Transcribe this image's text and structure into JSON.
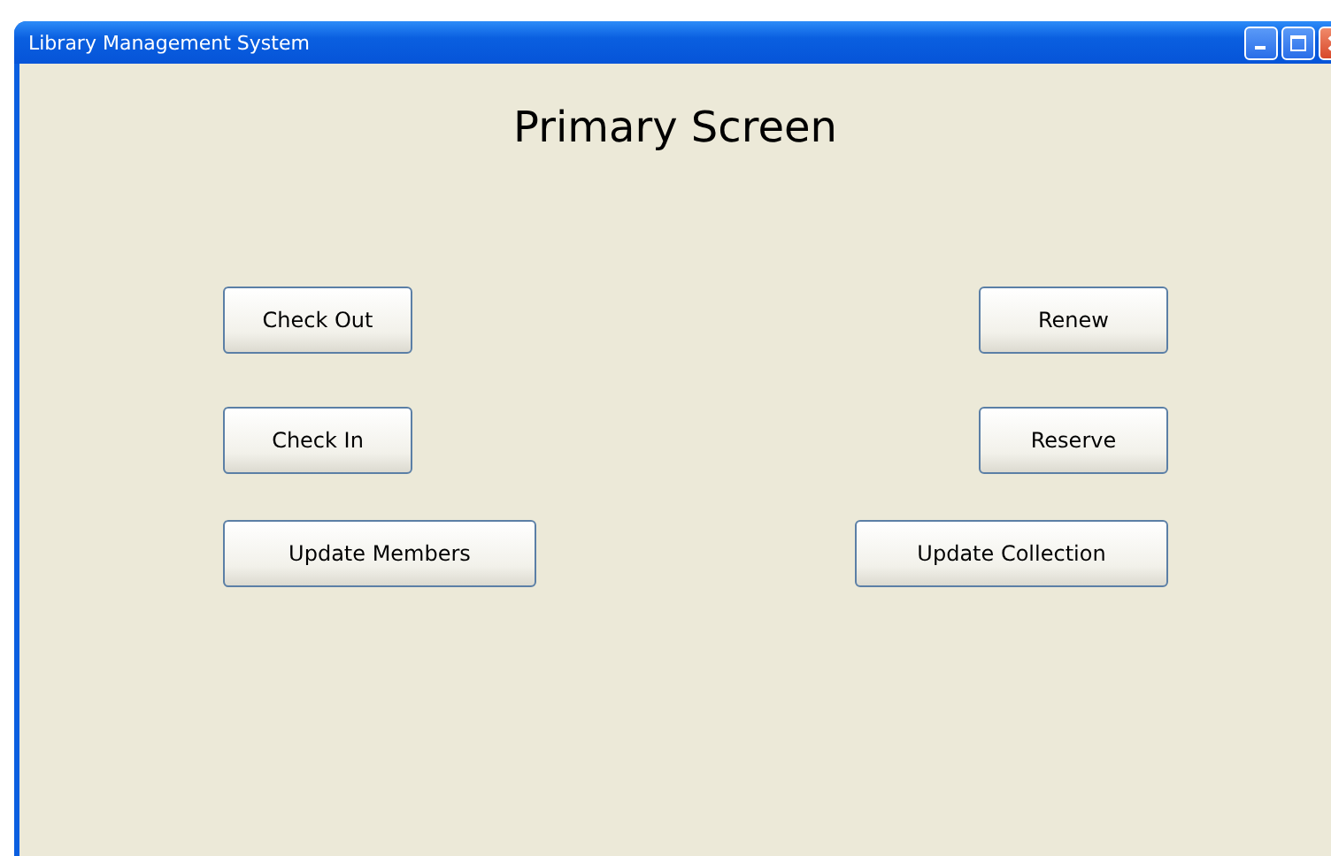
{
  "window": {
    "title": "Library Management System"
  },
  "heading": "Primary Screen",
  "rows": [
    {
      "left": "Check Out",
      "right": "Renew"
    },
    {
      "left": "Check In",
      "right": "Reserve"
    },
    {
      "left": "Update Members",
      "right": "Update Collection"
    }
  ]
}
